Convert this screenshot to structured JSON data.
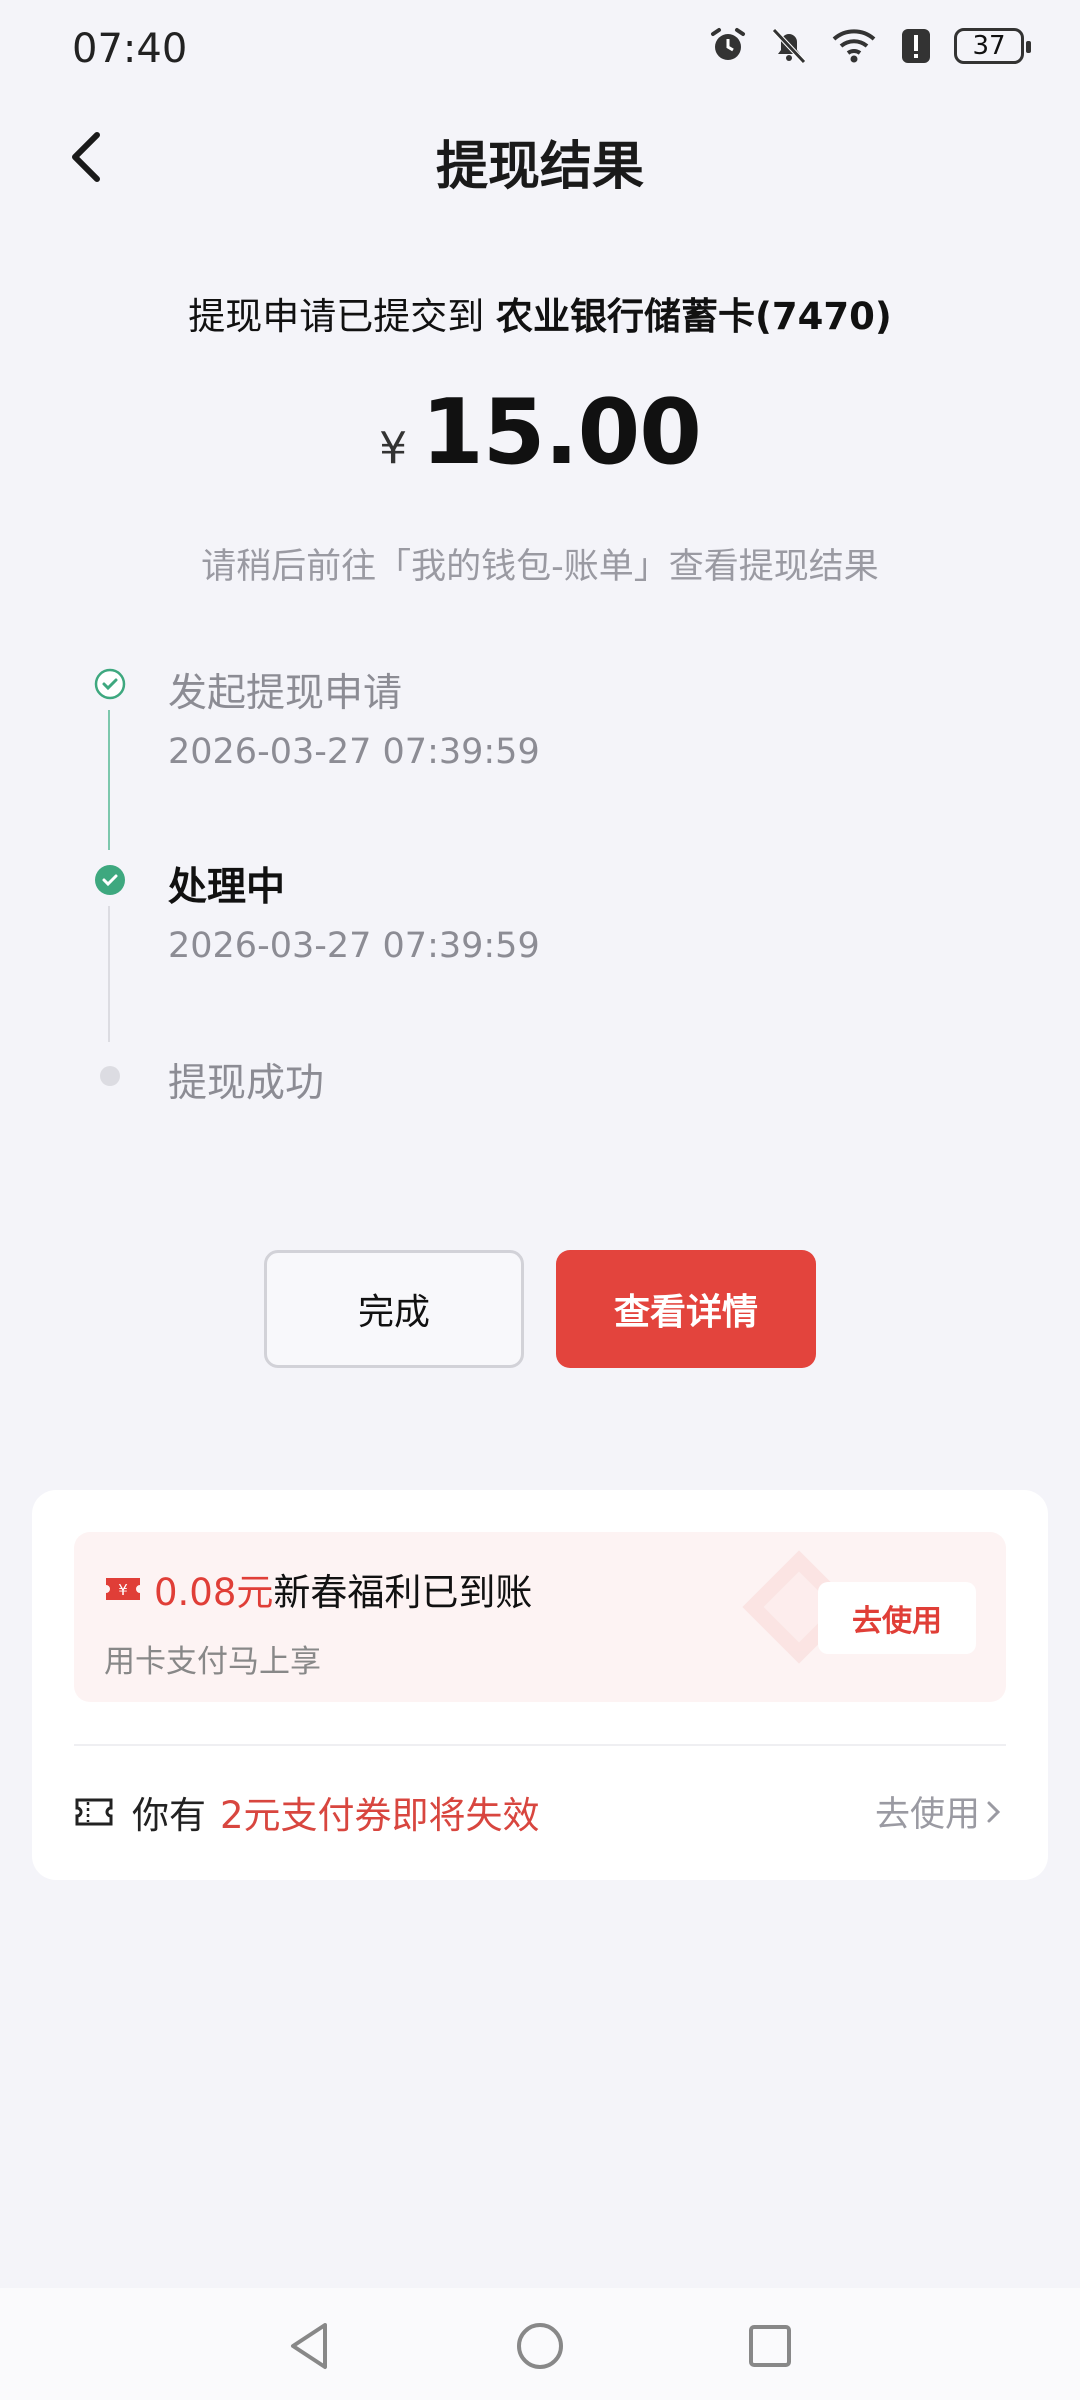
{
  "status": {
    "time": "07:40",
    "battery": "37"
  },
  "nav": {
    "title": "提现结果"
  },
  "destination": {
    "prefix": "提现申请已提交到",
    "bank": "农业银行储蓄卡(7470)"
  },
  "amount": {
    "currency": "¥",
    "value": "15.00"
  },
  "hint": "请稍后前往「我的钱包-账单」查看提现结果",
  "timeline": [
    {
      "title": "发起提现申请",
      "time": "2026-03-27 07:39:59",
      "state": "done"
    },
    {
      "title": "处理中",
      "time": "2026-03-27 07:39:59",
      "state": "current"
    },
    {
      "title": "提现成功",
      "time": "",
      "state": "pending"
    }
  ],
  "buttons": {
    "done": "完成",
    "detail": "查看详情"
  },
  "promo": {
    "coupon_glyph": "¥",
    "amount": "0.08元",
    "title": "新春福利已到账",
    "subtitle": "用卡支付马上享",
    "cta": "去使用"
  },
  "expire": {
    "prefix": "你有",
    "highlight": "2元支付券即将失效",
    "cta": "去使用"
  },
  "colors": {
    "accent": "#e3443d",
    "success": "#3ea87f",
    "background": "#f4f4f9"
  },
  "icons": [
    "back-arrow-icon",
    "alarm-icon",
    "mute-bell-icon",
    "wifi-icon",
    "alert-icon",
    "battery-icon",
    "check-circle-icon",
    "coupon-icon",
    "ticket-icon",
    "chevron-right-icon",
    "nav-back-icon",
    "nav-home-icon",
    "nav-recents-icon"
  ]
}
